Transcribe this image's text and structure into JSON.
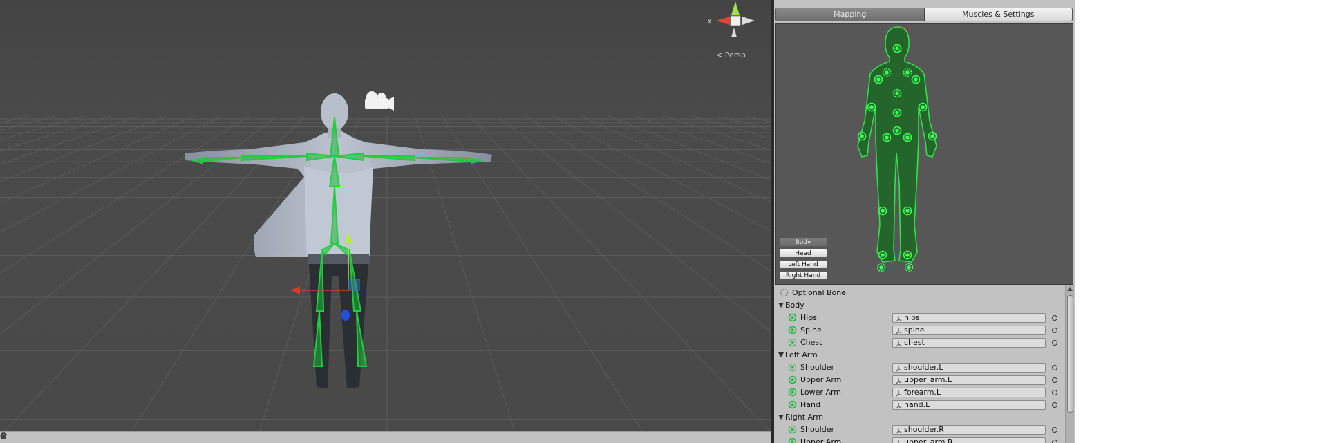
{
  "scene": {
    "projection_label": "Persp",
    "status_text": "or",
    "colors": {
      "background": "#484848",
      "grid": "#5a5a5a",
      "bone": "#22c940",
      "mesh": "#aeb8c8"
    }
  },
  "inspector": {
    "tabs": [
      {
        "label": "Mapping",
        "active": true
      },
      {
        "label": "Muscles & Settings",
        "active": false
      }
    ],
    "part_buttons": [
      {
        "label": "Body",
        "active": true
      },
      {
        "label": "Head",
        "active": false
      },
      {
        "label": "Left Hand",
        "active": false
      },
      {
        "label": "Right Hand",
        "active": false
      }
    ],
    "optional_bone_label": "Optional Bone",
    "groups": [
      {
        "label": "Body",
        "bones": [
          {
            "label": "Hips",
            "value": "hips",
            "optional": false
          },
          {
            "label": "Spine",
            "value": "spine",
            "optional": false
          },
          {
            "label": "Chest",
            "value": "chest",
            "optional": true
          }
        ]
      },
      {
        "label": "Left Arm",
        "bones": [
          {
            "label": "Shoulder",
            "value": "shoulder.L",
            "optional": true
          },
          {
            "label": "Upper Arm",
            "value": "upper_arm.L",
            "optional": false
          },
          {
            "label": "Lower Arm",
            "value": "forearm.L",
            "optional": false
          },
          {
            "label": "Hand",
            "value": "hand.L",
            "optional": false
          }
        ]
      },
      {
        "label": "Right Arm",
        "bones": [
          {
            "label": "Shoulder",
            "value": "shoulder.R",
            "optional": true
          },
          {
            "label": "Upper Arm",
            "value": "upper_arm.R",
            "optional": false
          }
        ]
      }
    ],
    "colors": {
      "avatar_fill": "#1f5a26",
      "avatar_stroke": "#2fe040",
      "panel_bg": "#c2c2c2"
    }
  }
}
